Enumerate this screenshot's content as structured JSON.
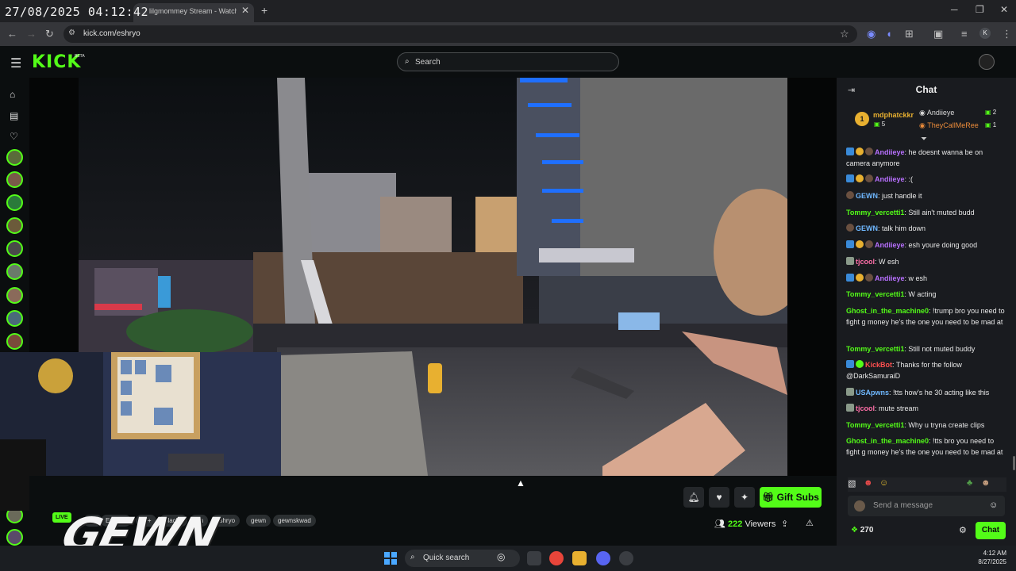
{
  "overlay": {
    "timestamp": "27/08/2025 04:12:42"
  },
  "browser": {
    "tab_title": "lilgmommey Stream - Watch Li...",
    "url": "kick.com/eshryo",
    "profile_initial": "K"
  },
  "header": {
    "logo": "KICK",
    "beta": "BETA",
    "search_placeholder": "Search"
  },
  "video_overlay": {
    "live_label": "LIVE",
    "brand_text": "GEWN"
  },
  "stream": {
    "tags": [
      "IRL",
      "English",
      "18+",
      "blacks",
      "yrn",
      "eshryo",
      "gewn",
      "gewnskwad"
    ],
    "gift_label": "Gift Subs",
    "viewers_count": "222",
    "viewers_label": "Viewers"
  },
  "chat": {
    "title": "Chat",
    "leaderboard": [
      {
        "name": "mdphatckkr",
        "count": "5",
        "rank": "1"
      },
      {
        "name": "Andiieye",
        "count": "2"
      },
      {
        "name": "TheyCallMeRee",
        "count": "1"
      }
    ],
    "messages": [
      {
        "user": "Andiieye",
        "text": ": he doesnt wanna be on camera anymore",
        "color": "#b870ff"
      },
      {
        "user": "Andiieye",
        "text": ": :(",
        "color": "#b870ff"
      },
      {
        "user": "GEWN",
        "text": ": just handle it",
        "color": "#6fb8ff"
      },
      {
        "user": "Tommy_vercetti1",
        "text": ": Still ain't muted budd",
        "color": "#53fc18"
      },
      {
        "user": "GEWN",
        "text": ": talk him down",
        "color": "#6fb8ff"
      },
      {
        "user": "Andiieye",
        "text": ": esh youre doing good",
        "color": "#b870ff"
      },
      {
        "user": "tjcool",
        "text": ": W esh",
        "color": "#ff6fa8"
      },
      {
        "user": "Andiieye",
        "text": ": w esh",
        "color": "#b870ff"
      },
      {
        "user": "Tommy_vercetti1",
        "text": ": W acting",
        "color": "#53fc18"
      },
      {
        "user": "Ghost_in_the_machine0",
        "text": ": !trump bro you need to fight g money he's the one you need to be mad at",
        "color": "#53fc18"
      },
      {
        "user": "Tommy_vercetti1",
        "text": ": Still not muted buddy",
        "color": "#53fc18"
      },
      {
        "user": "KickBot",
        "text": ": Thanks for the follow @DarkSamuraiD",
        "color": "#ff4f4f"
      },
      {
        "user": "USApwns",
        "text": ": !tts how's he 30 acting like this",
        "color": "#6fb8ff"
      },
      {
        "user": "tjcool",
        "text": ": mute stream",
        "color": "#ff6fa8"
      },
      {
        "user": "Tommy_vercetti1",
        "text": ": Why u tryna create clips",
        "color": "#53fc18"
      },
      {
        "user": "Ghost_in_the_machine0",
        "text": ": !tts bro you need to fight g money he's the one you need to be mad at",
        "color": "#53fc18"
      }
    ],
    "input_placeholder": "Send a message",
    "points": "270",
    "send_label": "Chat"
  },
  "taskbar": {
    "search_label": "Quick search",
    "time": "4:12 AM",
    "date": "8/27/2025"
  },
  "colors": {
    "accent": "#53fc18",
    "bg": "#0b0e0f",
    "chat_bg": "#191b1f"
  }
}
